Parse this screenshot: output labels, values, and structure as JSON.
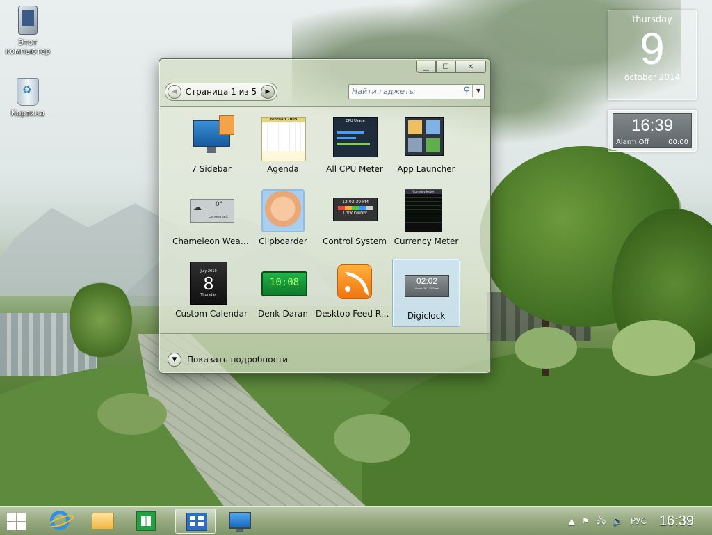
{
  "desktop": {
    "icons": [
      {
        "label": "Этот компьютер",
        "icon": "computer-icon"
      },
      {
        "label": "Корзина",
        "icon": "recycle-bin-icon"
      }
    ]
  },
  "calendar_gadget": {
    "weekday": "thursday",
    "day": "9",
    "month_year": "october 2014"
  },
  "clock_gadget": {
    "time": "16:39",
    "alarm_label": "Alarm Off",
    "alarm_time": "00:00"
  },
  "gallery": {
    "page_label": "Страница 1 из 5",
    "search_placeholder": "Найти гаджеты",
    "details_label": "Показать подробности",
    "gadgets": [
      {
        "name": "7 Sidebar",
        "icon": "sidebar-icon"
      },
      {
        "name": "Agenda",
        "icon": "agenda-icon",
        "thumb_title": "februari 2009"
      },
      {
        "name": "All CPU Meter",
        "icon": "cpu-meter-icon",
        "thumb_title": "CPU Usage"
      },
      {
        "name": "App Launcher",
        "icon": "app-launcher-icon"
      },
      {
        "name": "Chameleon Weather",
        "icon": "weather-icon",
        "thumb_temp": "0°",
        "thumb_city": "Langemark"
      },
      {
        "name": "Clipboarder",
        "icon": "clipboard-icon"
      },
      {
        "name": "Control System",
        "icon": "control-system-icon",
        "thumb_time": "12:03:30 PM",
        "thumb_lock": "LOCK ON/OFF"
      },
      {
        "name": "Currency Meter",
        "icon": "currency-icon",
        "thumb_title": "Currency Meter"
      },
      {
        "name": "Custom Calendar",
        "icon": "calendar-icon",
        "thumb_month": "July 2010",
        "thumb_day": "8",
        "thumb_weekday": "Thursday"
      },
      {
        "name": "Denk-Daran",
        "icon": "digital-clock-icon",
        "thumb_time": "10:08"
      },
      {
        "name": "Desktop Feed Reader",
        "icon": "rss-feed-icon"
      },
      {
        "name": "Digiclock",
        "icon": "digiclock-icon",
        "thumb_time": "02:02",
        "thumb_sub": "Alarm Off   12:03 am",
        "selected": true
      }
    ]
  },
  "taskbar": {
    "items": [
      {
        "icon": "start-icon"
      },
      {
        "icon": "internet-explorer-icon"
      },
      {
        "icon": "file-explorer-icon"
      },
      {
        "icon": "store-icon"
      },
      {
        "icon": "gadget-gallery-icon",
        "active": true
      },
      {
        "icon": "desktop-gadgets-icon"
      }
    ],
    "language": "РУС",
    "time": "16:39"
  },
  "colors": {
    "accent": "#2d8fe6",
    "taskbar": "#98ab82",
    "selection": "#c8e1f5"
  }
}
